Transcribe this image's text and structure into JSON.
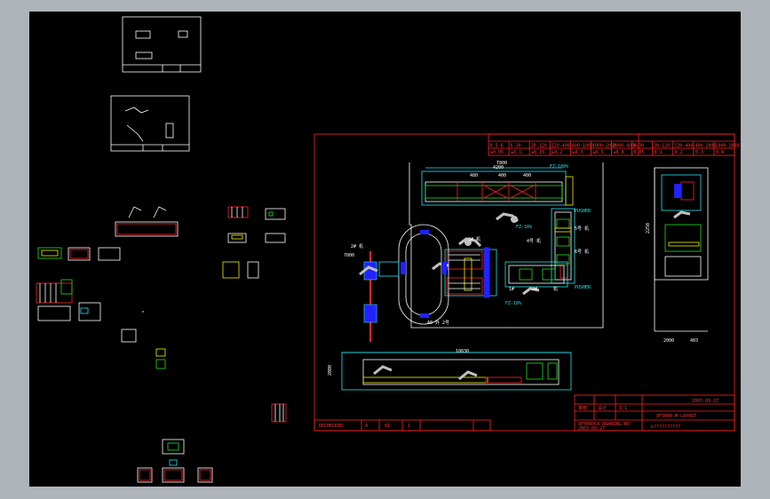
{
  "drawing": {
    "scale_rows": {
      "ranges": [
        "0.5-6",
        "6-30",
        "30-120",
        "120-400",
        "400-1000",
        "1000-2000",
        "2000-4000",
        "6-30",
        "30-120",
        "120-400",
        "400-1000",
        "1000-2000"
      ],
      "tolerances": [
        "±0.05",
        "±0.1",
        "±0.15",
        "±0.2",
        "±0.3",
        "±0.5",
        "±0.8",
        "0.05",
        "0.1",
        "0.2",
        "0.3",
        "0.4"
      ]
    },
    "dimensions": {
      "top_width": "4200",
      "top_sub": [
        "480",
        "400",
        "400"
      ],
      "side_height": "2250",
      "bottom_width": "2000",
      "bottom_small": "403",
      "front_width": "10830",
      "front_height": "2000",
      "plan_left": "7000",
      "plan_top": "T800"
    },
    "labels": {
      "pusher_top": "PUSHER",
      "pusher_bottom": "PUSHER",
      "fz_top": "FZ-100%",
      "fz_mid": "FZ-10%",
      "fz_low": "FZ-10%",
      "l1": "2# 机",
      "l2": "3# 机",
      "l3": "5号 机",
      "l4": "4号 机",
      "l5": "6号 机",
      "l6": "1#",
      "l7": "2#",
      "l8": "机",
      "l9": "A0 外 2号"
    },
    "title_block": {
      "date": "2003-09-27",
      "drawing_no": "XF3000-M-LAYOUT",
      "scale": "1:1",
      "sheet": "01",
      "qty": "1",
      "rev": "A",
      "company": "©??????????",
      "approve": "审核",
      "design": "设计",
      "left_note": "RECHECKED",
      "bottom_left": "XF3000CA DRAWING NO:",
      "bottom_left2": "2003-09-27"
    }
  },
  "colors": {
    "background": "#000000",
    "canvas": "#aeb4ba",
    "frame": "#ff2222",
    "cyan": "#22e5f0",
    "yellow": "#f5f000",
    "green": "#20e020"
  }
}
